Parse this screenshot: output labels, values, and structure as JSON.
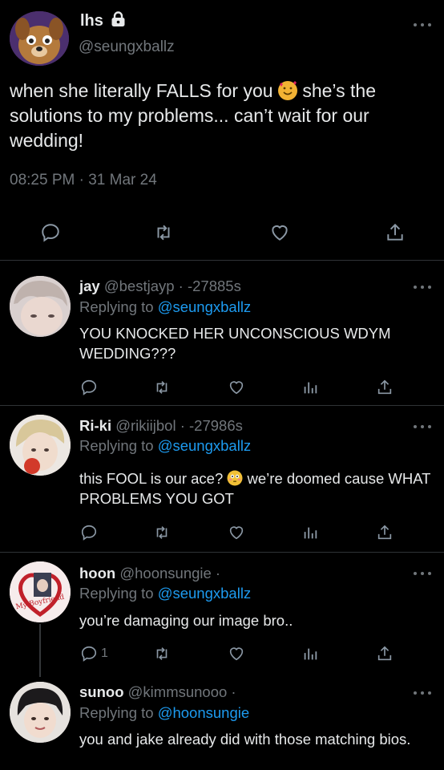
{
  "main": {
    "name": "lhs",
    "handle": "@seungxballz",
    "text_before": "when she literally FALLS for you ",
    "text_after": " she’s the solutions to my problems... can’t wait for our wedding!",
    "time": "08:25 PM · 31 Mar 24"
  },
  "replies": [
    {
      "name": "jay",
      "handle": "@bestjayp",
      "meta": " · -27885s",
      "replying_prefix": "Replying to ",
      "replying_to": "@seungxballz",
      "text": "YOU KNOCKED HER UNCONSCIOUS WDYM WEDDING???",
      "reply_count": ""
    },
    {
      "name": "Ri-ki",
      "handle": "@rikiijbol",
      "meta": " · -27986s",
      "replying_prefix": "Replying to ",
      "replying_to": "@seungxballz",
      "text_before": "this FOOL is our ace? ",
      "text_after": "  we’re doomed cause WHAT PROBLEMS YOU GOT",
      "reply_count": ""
    },
    {
      "name": "hoon",
      "handle": "@hoonsungie",
      "meta": " ·",
      "replying_prefix": "Replying to ",
      "replying_to": "@seungxballz",
      "text": "you’re damaging our image bro..",
      "reply_count": "1"
    },
    {
      "name": "sunoo",
      "handle": "@kimmsunooo",
      "meta": " ·",
      "replying_prefix": "Replying to ",
      "replying_to": "@hoonsungie",
      "text": "you and jake already did with those matching bios."
    }
  ],
  "avatar_labels": {
    "hoon_sticker": "My Boyfriend"
  },
  "colors": {
    "background": "#000000",
    "text": "#e7e9ea",
    "muted": "#71767b",
    "link": "#1d9bf0",
    "divider": "#2f3336"
  }
}
